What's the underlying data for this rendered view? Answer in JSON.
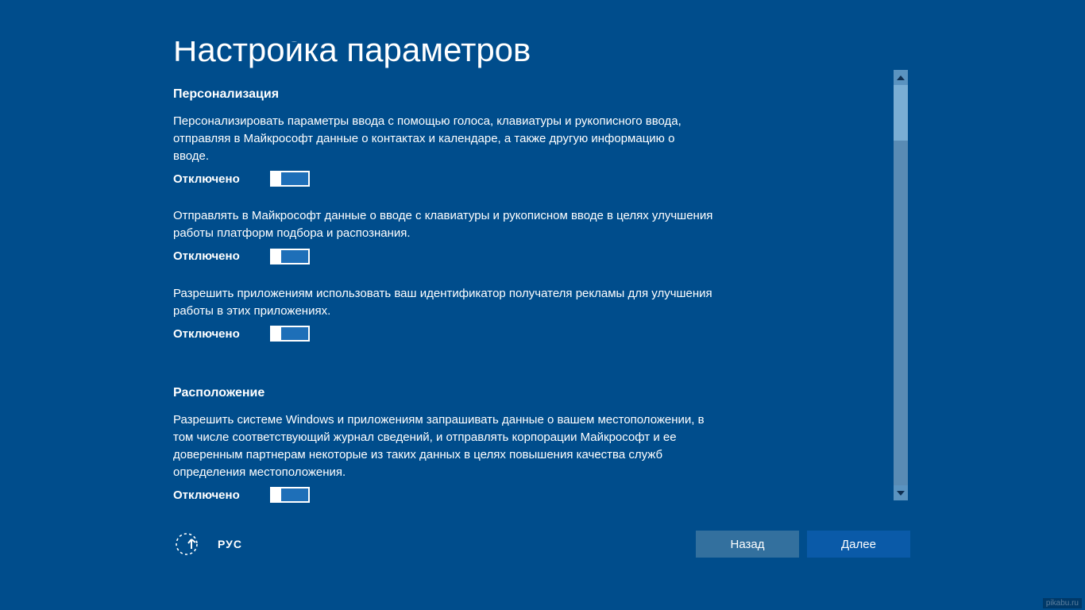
{
  "page": {
    "title": "Настройка параметров"
  },
  "sections": {
    "personalization": {
      "heading": "Персонализация",
      "items": [
        {
          "desc": "Персонализировать параметры ввода с помощью голоса, клавиатуры и рукописного ввода, отправляя в Майкрософт данные о контактах и календаре, а также другую информацию о вводе.",
          "state_label": "Отключено",
          "state": "off"
        },
        {
          "desc": "Отправлять в Майкрософт данные о вводе с клавиатуры и рукописном вводе в целях улучшения работы платформ подбора и распознания.",
          "state_label": "Отключено",
          "state": "off"
        },
        {
          "desc": "Разрешить приложениям использовать ваш идентификатор получателя рекламы для улучшения работы в этих приложениях.",
          "state_label": "Отключено",
          "state": "off"
        }
      ]
    },
    "location": {
      "heading": "Расположение",
      "items": [
        {
          "desc": "Разрешить системе Windows и приложениям запрашивать данные о вашем местоположении, в том числе соответствующий журнал сведений, и отправлять корпорации Майкрософт и ее доверенным партнерам некоторые из таких данных в целях повышения качества служб определения местоположения.",
          "state_label": "Отключено",
          "state": "off"
        }
      ]
    }
  },
  "footer": {
    "language": "РУС",
    "back": "Назад",
    "next": "Далее"
  },
  "watermark": "pikabu.ru"
}
